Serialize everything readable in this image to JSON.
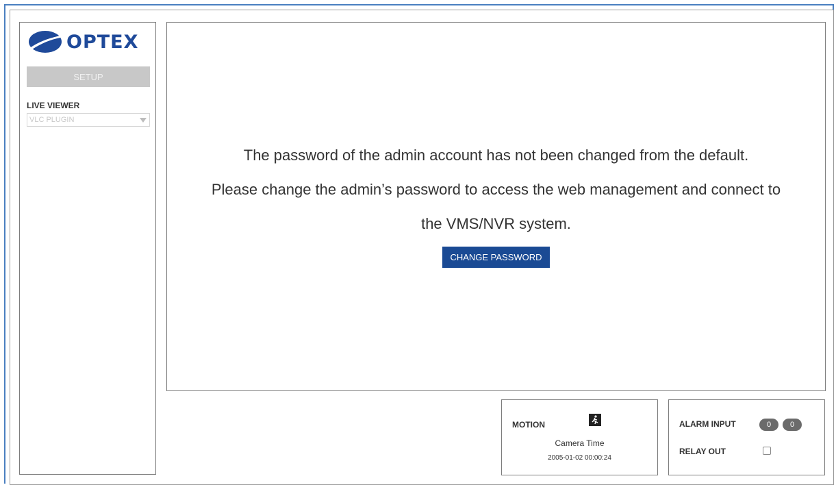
{
  "brand": {
    "logo_text": "OPTEX"
  },
  "sidebar": {
    "setup_label": "SETUP",
    "live_viewer_label": "LIVE VIEWER",
    "live_viewer_selected": "VLC PLUGIN"
  },
  "notice": {
    "line1": "The password of the admin account has not been changed from the default.",
    "line2": "Please change the admin’s password to access the web management and connect to",
    "line3": "the VMS/NVR system.",
    "button_label": "CHANGE PASSWORD"
  },
  "status": {
    "motion_label": "MOTION",
    "camera_time_label": "Camera Time",
    "camera_time_value": "2005-01-02 00:00:24",
    "alarm_input_label": "ALARM INPUT",
    "alarm_inputs": [
      "0",
      "0"
    ],
    "relay_out_label": "RELAY OUT"
  },
  "colors": {
    "brand_blue": "#1f4a9a",
    "button_blue": "#1a4a94",
    "setup_gray": "#c8c8c8",
    "frame_blue": "#4a7fc0"
  }
}
